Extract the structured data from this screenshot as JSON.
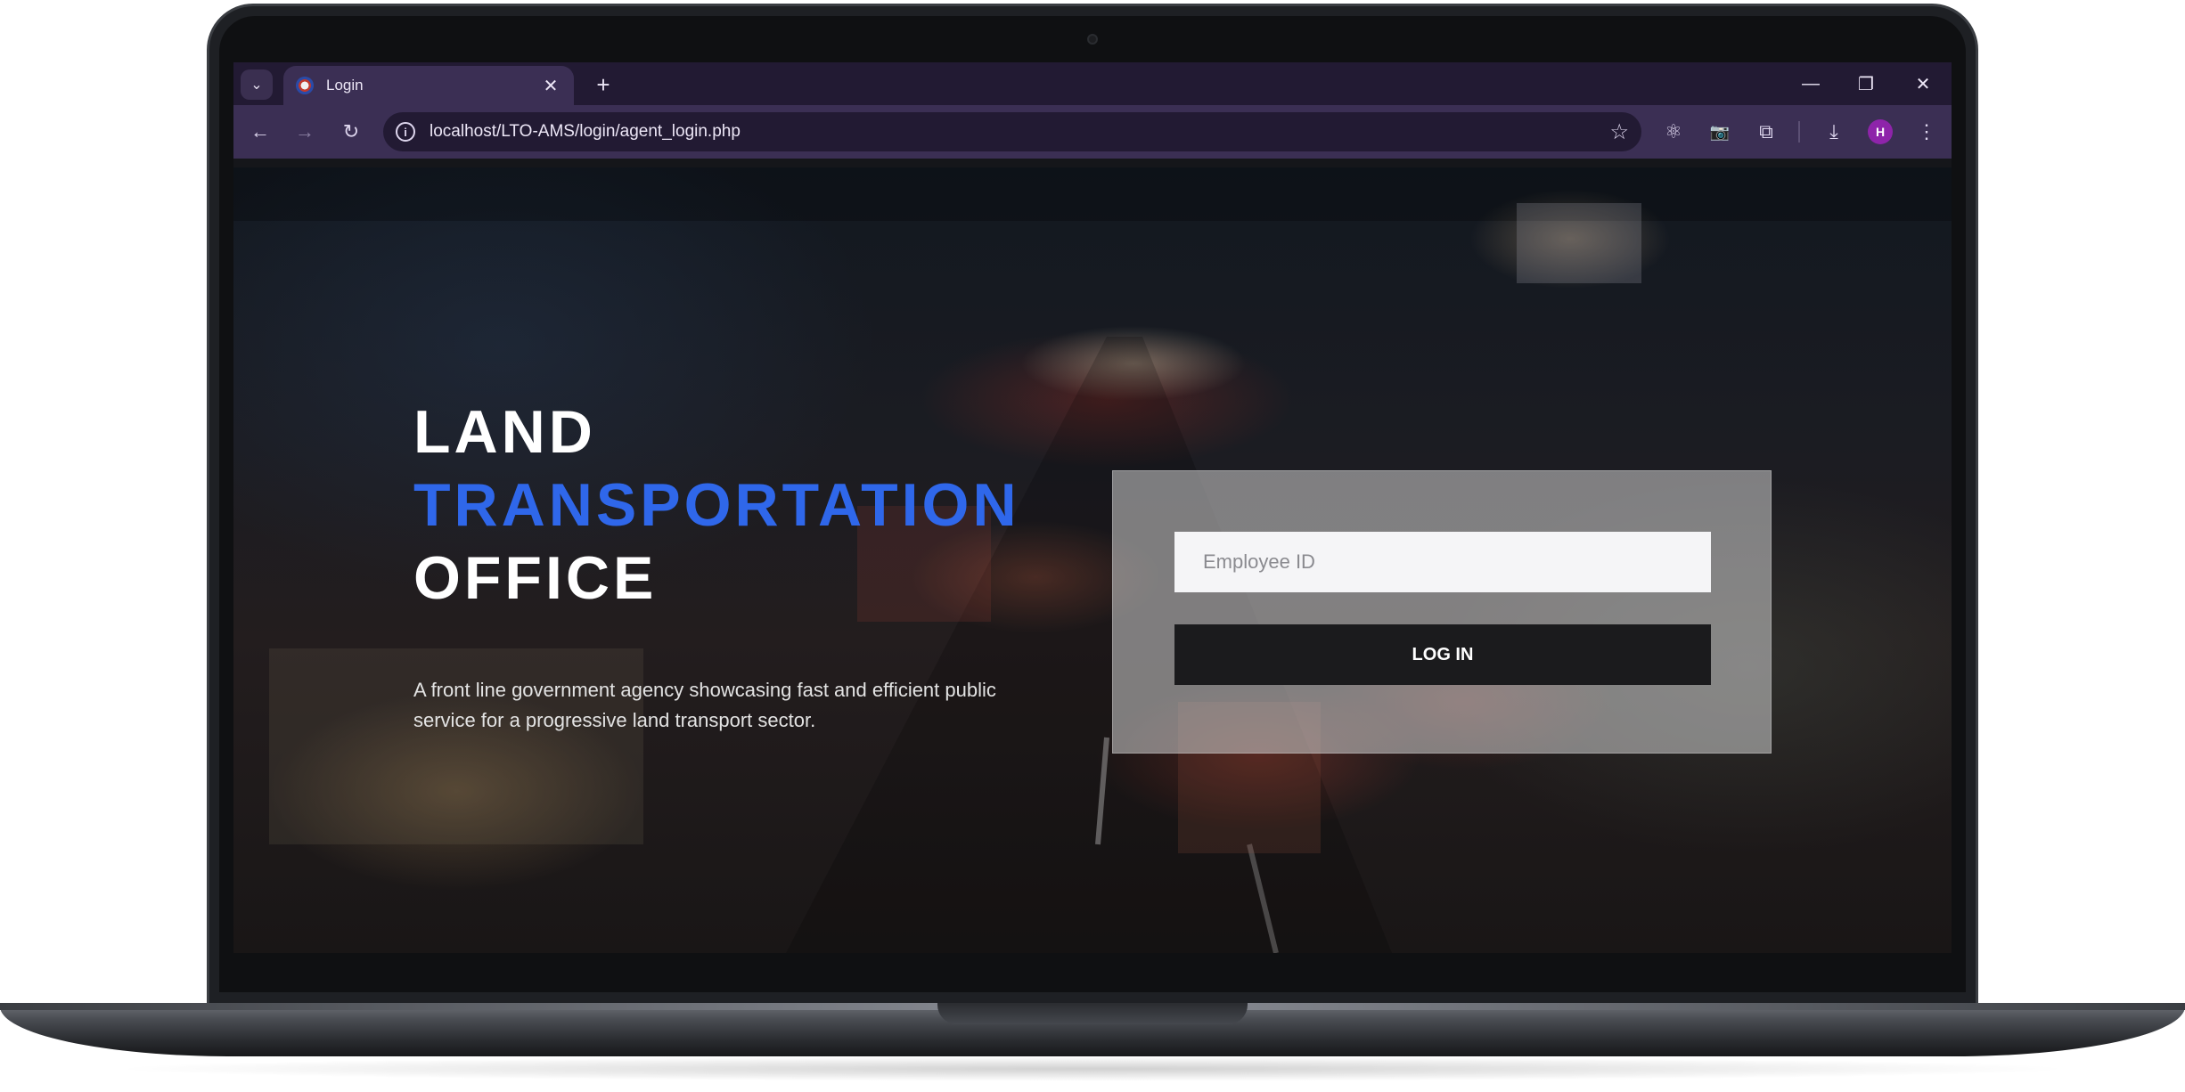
{
  "browser": {
    "tab_title": "Login",
    "url": "localhost/LTO-AMS/login/agent_login.php",
    "profile_initial": "H",
    "icons": {
      "tab_search": "chevron-down",
      "tab_close": "close",
      "new_tab": "plus",
      "minimize": "minimize",
      "restore": "restore",
      "close": "close",
      "back": "arrow-left",
      "forward": "arrow-right",
      "reload": "reload",
      "site_info": "info",
      "bookmark": "star",
      "extension_react": "react",
      "extension_camera": "camera",
      "extensions": "puzzle",
      "downloads": "download",
      "menu": "kebab"
    },
    "glyphs": {
      "tab_search": "⌄",
      "tab_close": "✕",
      "new_tab": "+",
      "minimize": "—",
      "restore": "❐",
      "close": "✕",
      "back": "←",
      "forward": "→",
      "reload": "↻",
      "site_info": "i",
      "bookmark": "☆",
      "extension_react": "⚛",
      "extension_camera": "📷",
      "extensions": "⧉",
      "downloads": "⤓",
      "menu": "⋮"
    }
  },
  "hero": {
    "title_line1": "LAND",
    "title_line2": "TRANSPORTATION",
    "title_line3": "OFFICE",
    "tagline": "A front line government agency showcasing fast and efficient public service for a progressive land transport sector."
  },
  "login": {
    "employee_id_placeholder": "Employee ID",
    "employee_id_value": "",
    "login_label": "LOG IN"
  },
  "colors": {
    "accent": "#2f67ea",
    "button": "#1b1b1d",
    "browser_frame": "#3b2f54",
    "profile_badge": "#8e24aa"
  }
}
